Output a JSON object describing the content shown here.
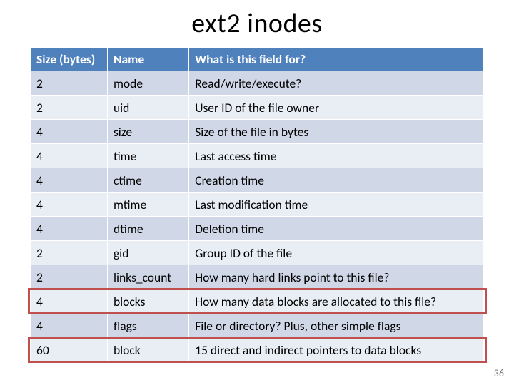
{
  "title": "ext2 inodes",
  "page_number": "36",
  "columns": {
    "size": "Size (bytes)",
    "name": "Name",
    "desc": "What is this field for?"
  },
  "rows": [
    {
      "size": "2",
      "name": "mode",
      "desc": "Read/write/execute?"
    },
    {
      "size": "2",
      "name": "uid",
      "desc": "User ID of the file owner"
    },
    {
      "size": "4",
      "name": "size",
      "desc": "Size of the file in bytes"
    },
    {
      "size": "4",
      "name": "time",
      "desc": "Last access time"
    },
    {
      "size": "4",
      "name": "ctime",
      "desc": "Creation time"
    },
    {
      "size": "4",
      "name": "mtime",
      "desc": "Last modification time"
    },
    {
      "size": "4",
      "name": "dtime",
      "desc": "Deletion time"
    },
    {
      "size": "2",
      "name": "gid",
      "desc": "Group ID of the file"
    },
    {
      "size": "2",
      "name": "links_count",
      "desc": "How many hard links point to this file?"
    },
    {
      "size": "4",
      "name": "blocks",
      "desc": "How many data blocks are allocated to this file?"
    },
    {
      "size": "4",
      "name": "flags",
      "desc": "File or directory? Plus, other simple flags"
    },
    {
      "size": "60",
      "name": "block",
      "desc": "15 direct and indirect pointers to data blocks"
    }
  ],
  "highlight_rows": [
    9,
    11
  ]
}
